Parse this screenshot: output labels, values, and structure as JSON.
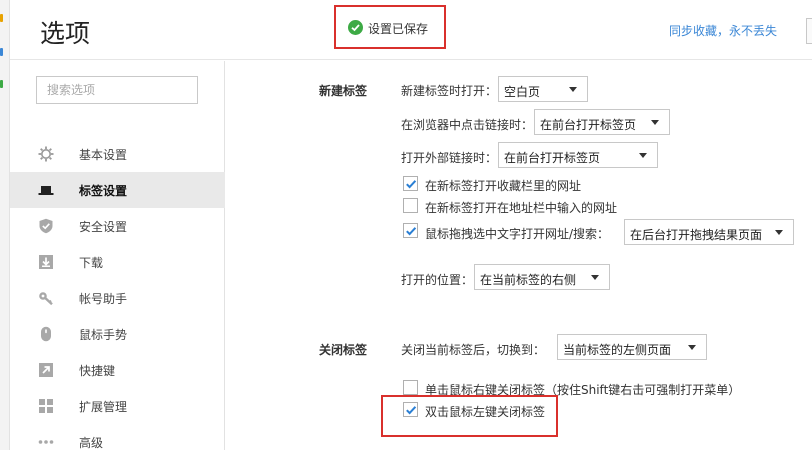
{
  "header": {
    "title": "选项",
    "saved_status": "设置已保存",
    "sync_link": "同步收藏，永不丢失"
  },
  "sidebar": {
    "search_placeholder": "搜索选项",
    "items": [
      {
        "label": "基本设置",
        "icon": "gear-icon",
        "active": false
      },
      {
        "label": "标签设置",
        "icon": "laptop-icon",
        "active": true
      },
      {
        "label": "安全设置",
        "icon": "shield-check-icon",
        "active": false
      },
      {
        "label": "下载",
        "icon": "download-icon",
        "active": false
      },
      {
        "label": "帐号助手",
        "icon": "key-icon",
        "active": false
      },
      {
        "label": "鼠标手势",
        "icon": "mouse-icon",
        "active": false
      },
      {
        "label": "快捷键",
        "icon": "shortcut-arrow-icon",
        "active": false
      },
      {
        "label": "扩展管理",
        "icon": "grid-icon",
        "active": false
      },
      {
        "label": "高级",
        "icon": "more-dots-icon",
        "active": false
      }
    ]
  },
  "new_tab": {
    "section_title": "新建标签",
    "open_new_tab_label": "新建标签时打开：",
    "open_new_tab_value": "空白页",
    "middle_click_label": "在浏览器中点击链接时：",
    "middle_click_value": "在前台打开标签页",
    "external_link_label": "打开外部链接时：",
    "external_link_value": "在前台打开标签页",
    "cb_favorites_label": "在新标签打开收藏栏里的网址",
    "cb_favorites_checked": true,
    "cb_addressbar_label": "在新标签打开在地址栏中输入的网址",
    "cb_addressbar_checked": false,
    "cb_drag_label": "鼠标拖拽选中文字打开网址/搜索：",
    "cb_drag_checked": true,
    "drag_value": "在后台打开拖拽结果页面",
    "open_position_label": "打开的位置：",
    "open_position_value": "在当前标签的右侧"
  },
  "close_tab": {
    "section_title": "关闭标签",
    "switch_label": "关闭当前标签后，切换到：",
    "switch_value": "当前标签的左侧页面",
    "cb_right_click_label": "单击鼠标右键关闭标签（按住Shift键右击可强制打开菜单）",
    "cb_right_click_checked": false,
    "cb_double_click_label": "双击鼠标左键关闭标签",
    "cb_double_click_checked": true
  },
  "colors": {
    "accent_link": "#3b87d6",
    "highlight_red": "#d9302c",
    "success_green": "#3daa45",
    "checkmark_blue": "#2a7fd4"
  }
}
